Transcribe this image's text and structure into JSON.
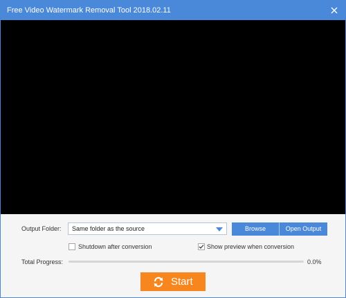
{
  "window": {
    "title": "Free Video Watermark Removal Tool 2018.02.11"
  },
  "output": {
    "label": "Output Folder:",
    "selected": "Same folder as the source",
    "browse_label": "Browse",
    "open_output_label": "Open Output"
  },
  "options": {
    "shutdown_label": "Shutdown after conversion",
    "shutdown_checked": false,
    "preview_label": "Show preview when conversion",
    "preview_checked": true
  },
  "progress": {
    "label": "Total Progress:",
    "percent_text": "0.0%",
    "value": 0.0
  },
  "start": {
    "label": "Start"
  },
  "colors": {
    "accent": "#4a88d9",
    "start": "#f7861f",
    "preview_background": "#000000"
  },
  "icons": {
    "close": "close-icon",
    "dropdown": "chevron-down-icon",
    "check": "checkmark-icon",
    "start": "refresh-icon"
  }
}
